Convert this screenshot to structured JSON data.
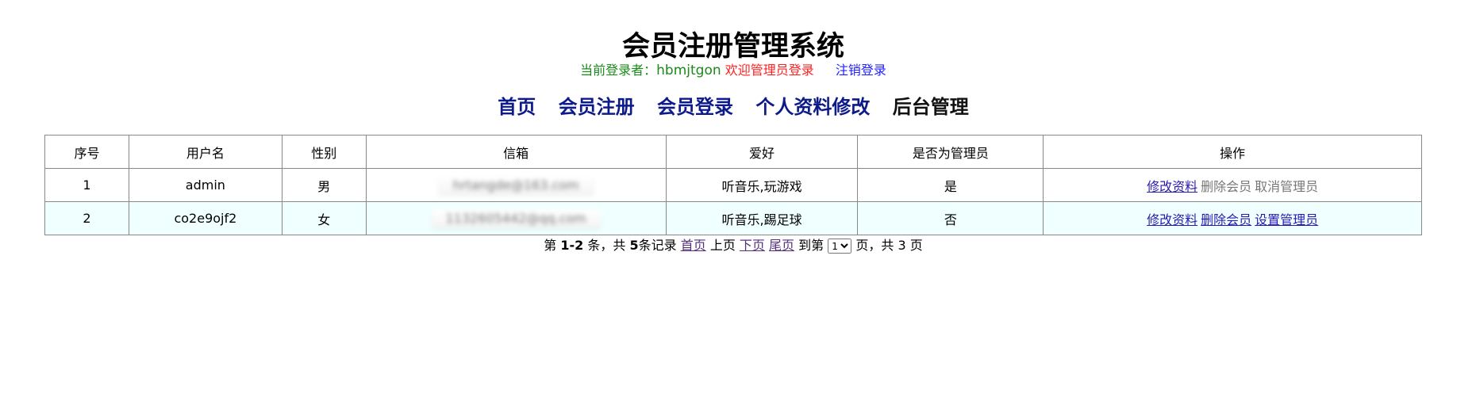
{
  "title": "会员注册管理系统",
  "login": {
    "label": "当前登录者：",
    "username": "hbmjtgon",
    "welcome": "欢迎管理员登录",
    "logout": "注销登录"
  },
  "nav": [
    {
      "label": "首页"
    },
    {
      "label": "会员注册"
    },
    {
      "label": "会员登录"
    },
    {
      "label": "个人资料修改"
    },
    {
      "label": "后台管理"
    }
  ],
  "table": {
    "headers": [
      "序号",
      "用户名",
      "性别",
      "信箱",
      "爱好",
      "是否为管理员",
      "操作"
    ],
    "rows": [
      {
        "index": "1",
        "username": "admin",
        "gender": "男",
        "email": "hrtangde@163.com",
        "hobby": "听音乐,玩游戏",
        "is_admin": "是",
        "ops": [
          "修改资料",
          "删除会员",
          "取消管理员"
        ]
      },
      {
        "index": "2",
        "username": "co2e9ojf2",
        "gender": "女",
        "email": "1132605442@qq.com",
        "hobby": "听音乐,踢足球",
        "is_admin": "否",
        "ops": [
          "修改资料",
          "删除会员",
          "设置管理员"
        ]
      }
    ]
  },
  "pager": {
    "t1": "第",
    "range": "1-2",
    "t2": "条，共",
    "total": "5",
    "t3": "条记录",
    "first": "首页",
    "prev": "上页",
    "next": "下页",
    "last": "尾页",
    "goto": "到第",
    "page_value": "1",
    "t4": "页，共",
    "pages": "3",
    "t5": "页"
  },
  "colors": {
    "nav": "#0c1a8a",
    "login_label": "#1a8a1a",
    "welcome": "#ff2020",
    "logout": "#2020ff",
    "row_alt_bg": "#f0ffff"
  }
}
